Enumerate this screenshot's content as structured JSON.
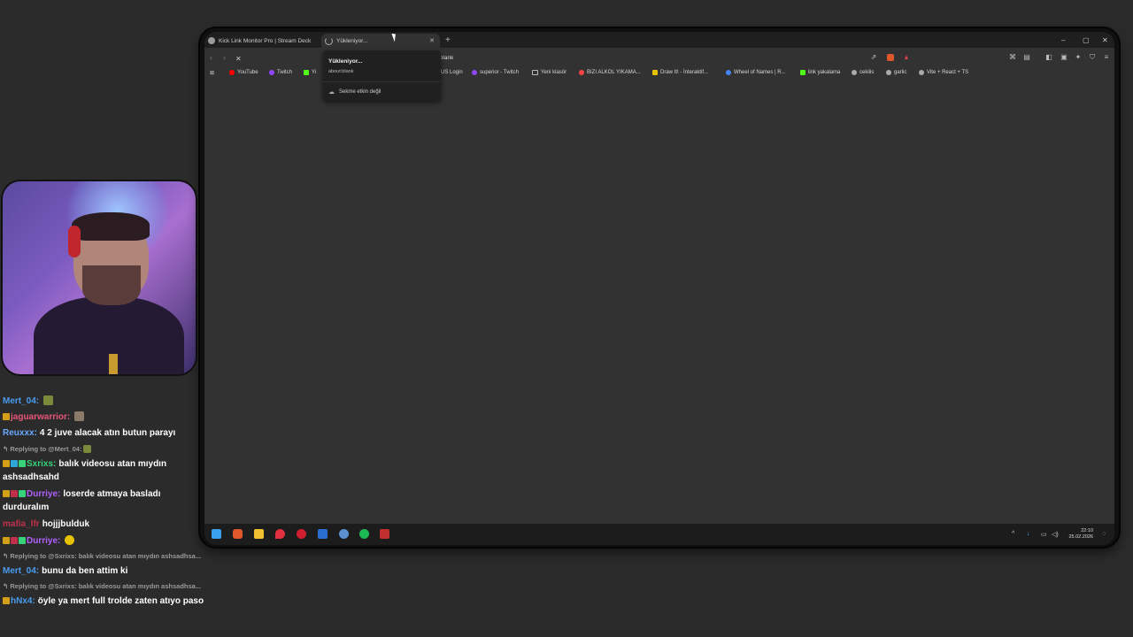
{
  "browser": {
    "tabs": [
      {
        "title": "Kick Link Monitor Pro | Stream Deck"
      },
      {
        "title": "Yükleniyor..."
      }
    ],
    "address": "about:blank",
    "address_visible": ":blank",
    "tooltip": {
      "title": "Yükleniyor...",
      "url": "about:blank",
      "inactive": "Sekme etkin değil"
    },
    "bookmarks": [
      {
        "label": "YouTube",
        "color": "#ff0000"
      },
      {
        "label": "Twitch",
        "color": "#9146ff"
      },
      {
        "label": "Yi",
        "color": "#53fc18"
      },
      {
        "label": "SUS Login",
        "color": "#888888"
      },
      {
        "label": "superior - Twitch",
        "color": "#9146ff"
      },
      {
        "label": "Yeni klasör",
        "color": "#bbbbbb"
      },
      {
        "label": "BIZI ALKOL YIKAMA...",
        "color": "#ff4444"
      },
      {
        "label": "Draw It! - İnteraktif...",
        "color": "#e6c200"
      },
      {
        "label": "Wheel of Names | R...",
        "color": "#4285f4"
      },
      {
        "label": "link yakalama",
        "color": "#53fc18"
      },
      {
        "label": "cekilis",
        "color": "#aaaaaa"
      },
      {
        "label": "garlic",
        "color": "#aaaaaa"
      },
      {
        "label": "Vite + React + TS",
        "color": "#aaaaaa"
      }
    ]
  },
  "taskbar": {
    "time": "22:10",
    "date": "25.02.2026",
    "icons": [
      "windows-icon",
      "brave-icon",
      "folder-icon",
      "maps-icon",
      "app-red-icon",
      "steam-icon",
      "app-blue-icon",
      "spotify-icon",
      "app-box-icon"
    ]
  },
  "chat": {
    "messages": [
      {
        "type": "msg",
        "user": "Mert_04:",
        "user_color": "#4a9bf0",
        "text": ""
      },
      {
        "type": "msg",
        "user": "jaguarwarrior:",
        "user_color": "#e8557a",
        "text": ""
      },
      {
        "type": "msg",
        "user": "Reuxxx:",
        "user_color": "#6aa9ff",
        "text": "4 2 juve alacak atın butun parayı"
      },
      {
        "type": "reply",
        "text": "Replying to @Mert_04:"
      },
      {
        "type": "msg",
        "user": "Sxrixs:",
        "user_color": "#37d37a",
        "text": "balık videosu atan mıydın"
      },
      {
        "type": "cont",
        "text": "ashsadhsahd"
      },
      {
        "type": "msg",
        "user": "Durriye:",
        "user_color": "#b060ff",
        "text": "loserde atmaya basladı"
      },
      {
        "type": "cont",
        "text": "durduralım"
      },
      {
        "type": "msg",
        "user": "mafia_lfr",
        "user_color": "#c0304a",
        "text": "hojjjbulduk"
      },
      {
        "type": "msg",
        "user": "Durriye:",
        "user_color": "#b060ff",
        "text": ""
      },
      {
        "type": "reply",
        "text": "Replying to @Sxrixs: balık videosu atan mıydın ashsadhsa..."
      },
      {
        "type": "msg",
        "user": "Mert_04:",
        "user_color": "#4a9bf0",
        "text": "bunu da ben attim ki"
      },
      {
        "type": "reply",
        "text": "Replying to @Sxrixs: balık videosu atan mıydın ashsadhsa..."
      },
      {
        "type": "msg",
        "user": "hNx4:",
        "user_color": "#4a9bf0",
        "text": "öyle ya mert full trolde zaten atıyo paso"
      }
    ]
  }
}
